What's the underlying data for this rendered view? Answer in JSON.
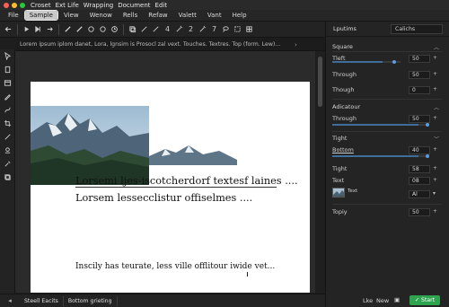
{
  "title_bar": {
    "items": [
      "Croset",
      "Ext Life",
      "Wrapping",
      "Document",
      "Edit"
    ]
  },
  "menu": {
    "items": [
      "File",
      "Sample",
      "View",
      "Wenow",
      "Rells",
      "Refaw",
      "Valett",
      "Vant",
      "Help"
    ],
    "active_index": 1
  },
  "toolbar": {
    "icons": [
      "back-arrow-icon",
      "play-icon",
      "next-icon",
      "step-icon",
      "pen-tool-icon",
      "line-tool-icon",
      "circle-icon",
      "sync-icon",
      "history-icon",
      "copy-icon",
      "brush-icon",
      "brush-alt-icon",
      "magic-wand-icon",
      "magic-wand-alt-icon",
      "lasso-icon",
      "transform-icon",
      "grid-icon"
    ],
    "numbers": [
      "4",
      "2",
      "7"
    ]
  },
  "path_bar": {
    "text": "Lorem ipsum iplom danet, Lora, lgnsim is Prosocl zal vext. Touches. Textres. Top (form. Lew)...",
    "chevron": "›"
  },
  "document": {
    "line1": "Lorsemi ljes-iscotcherdorf textesf laines ....",
    "line2": "Lorsem lessecclistur offiselmes ....",
    "line3": "Inscily has teurate, less ville offlitour iwide vet..."
  },
  "bottom_tabs": [
    "Steell Eacits",
    "Bottom grieting"
  ],
  "panel": {
    "header_title": "Lputims",
    "header_field": "Calichs",
    "sections": {
      "square": "Square",
      "adicatour": "Adicatour",
      "tight": "Tight"
    },
    "props": {
      "tleft": {
        "label": "Tleft",
        "value": "50",
        "level": 0.74
      },
      "through1": {
        "label": "Through",
        "value": "50"
      },
      "though": {
        "label": "Though",
        "value": "0"
      },
      "through2": {
        "label": "Through",
        "value": "50",
        "level": 0.92
      },
      "bottom": {
        "label": "Bottom",
        "value": "40",
        "level": 0.92
      },
      "tight": {
        "label": "Tight",
        "value": "58"
      },
      "text": {
        "label": "Text",
        "value": "08"
      },
      "swatch": {
        "label": "Text",
        "value": "Al"
      },
      "topiy": {
        "label": "Topiy",
        "value": "50"
      }
    },
    "footer": {
      "like": "Lke",
      "new": "New",
      "start": "Start"
    }
  },
  "colors": {
    "accent_blue": "#5a9de0",
    "start_green": "#2ea44f",
    "menu_active": "#c9c9c9"
  }
}
